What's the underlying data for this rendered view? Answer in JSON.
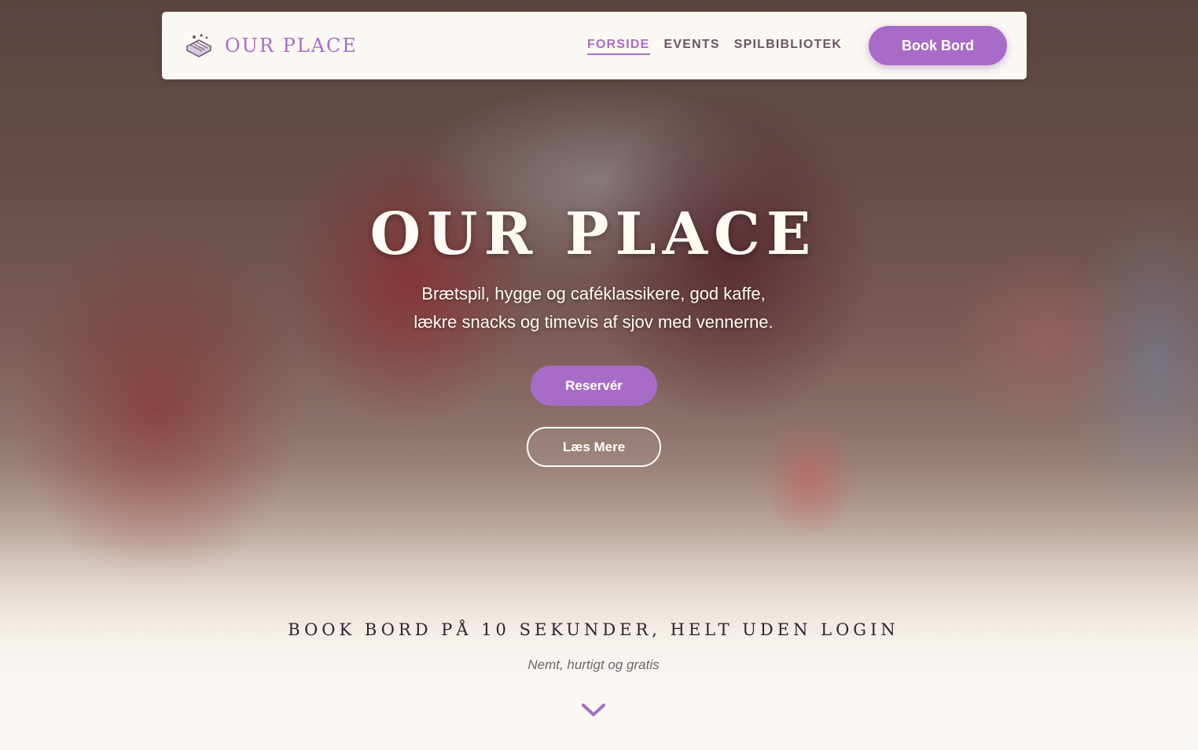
{
  "nav": {
    "brand_name": "OUR PLACE",
    "links": [
      {
        "label": "FORSIDE",
        "active": true
      },
      {
        "label": "EVENTS",
        "active": false
      },
      {
        "label": "SPILBIBLIOTEK",
        "active": false
      }
    ],
    "cta_label": "Book Bord"
  },
  "hero": {
    "title": "OUR PLACE",
    "subtitle_line1": "Brætspil, hygge og caféklassikere, god kaffe,",
    "subtitle_line2": "lækre snacks og timevis af sjov med vennerne.",
    "primary_button": "Reservér",
    "secondary_button": "Læs Mere"
  },
  "booking": {
    "heading": "BOOK BORD PÅ 10 SEKUNDER, HELT UDEN LOGIN",
    "subheading": "Nemt, hurtigt og gratis"
  },
  "icons": {
    "brand": "board-game-icon",
    "scroll": "chevron-down-icon"
  },
  "colors": {
    "accent": "#a86cc8",
    "nav_background": "#fbf8f3",
    "page_background": "#fbf7f3",
    "heading_text": "#2e2430"
  }
}
